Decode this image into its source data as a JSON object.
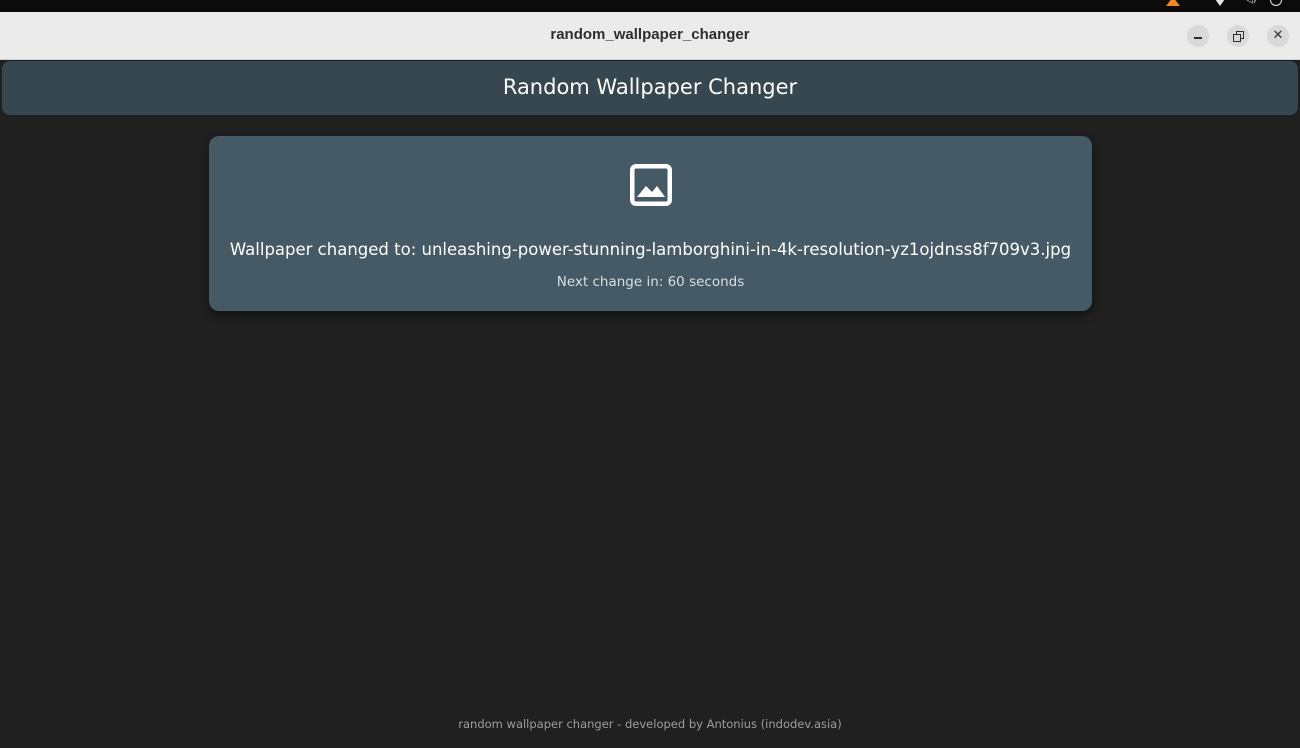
{
  "window": {
    "title": "random_wallpaper_changer",
    "controls": {
      "minimize_icon": "minimize-icon",
      "maximize_icon": "restore-icon",
      "close_icon": "close-icon"
    }
  },
  "appbar": {
    "title": "Random Wallpaper Changer"
  },
  "card": {
    "icon": "image-icon",
    "status_text": "Wallpaper changed to: unleashing-power-stunning-lamborghini-in-4k-resolution-yz1ojdnss8f709v3.jpg",
    "countdown_text": "Next change in: 60 seconds"
  },
  "footer": {
    "text": "random wallpaper changer - developed by Antonius (indodev.asia)"
  },
  "colors": {
    "background": "#202020",
    "appbar": "#37474f",
    "card": "#455a64",
    "titlebar": "#ebebeb"
  }
}
